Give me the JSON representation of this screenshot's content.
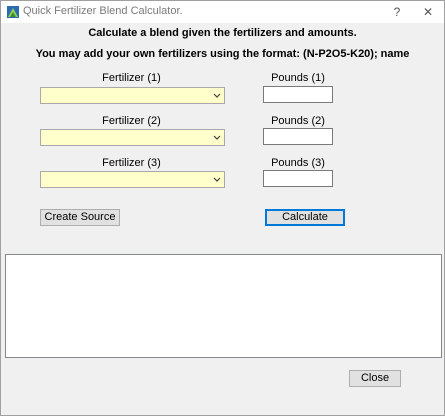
{
  "window": {
    "title": "Quick Fertilizer Blend Calculator.",
    "help_glyph": "?",
    "close_glyph": "✕"
  },
  "header": {
    "line1": "Calculate a blend given the fertilizers and amounts.",
    "line2": "You may add your own fertilizers using the format: (N-P2O5-K20); name"
  },
  "rows": [
    {
      "fertilizer_label": "Fertilizer (1)",
      "fertilizer_value": "",
      "pounds_label": "Pounds (1)",
      "pounds_value": ""
    },
    {
      "fertilizer_label": "Fertilizer (2)",
      "fertilizer_value": "",
      "pounds_label": "Pounds (2)",
      "pounds_value": ""
    },
    {
      "fertilizer_label": "Fertilizer (3)",
      "fertilizer_value": "",
      "pounds_label": "Pounds (3)",
      "pounds_value": ""
    }
  ],
  "buttons": {
    "create_source": "Create Source",
    "calculate": "Calculate",
    "close": "Close"
  },
  "output": {
    "text": ""
  },
  "icons": {
    "app": "fertilizer-app-icon",
    "dropdown": "chevron-down-icon"
  },
  "colors": {
    "combo_bg": "#ffffcc",
    "window_bg": "#f0f0f0",
    "default_button_border": "#0078d7"
  }
}
